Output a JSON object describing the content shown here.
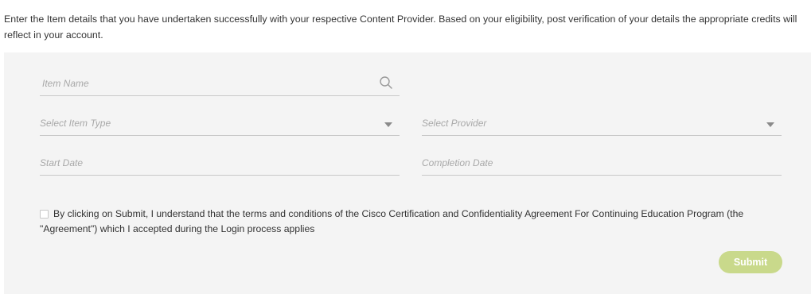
{
  "intro": {
    "text": "Enter the Item details that you have undertaken successfully with your respective Content Provider. Based on your eligibility, post verification of your details the appropriate credits will reflect in your account."
  },
  "form": {
    "item_name": {
      "placeholder": "Item Name",
      "icon": "search-icon"
    },
    "item_type": {
      "placeholder": "Select Item Type",
      "icon": "caret-down-icon"
    },
    "provider": {
      "placeholder": "Select Provider",
      "icon": "caret-down-icon"
    },
    "start_date": {
      "placeholder": "Start Date"
    },
    "completion_date": {
      "placeholder": "Completion Date"
    },
    "agreement": {
      "checked": false,
      "text": "By clicking on Submit, I understand that the terms and conditions of the Cisco Certification and Confidentiality Agreement For Continuing Education Program (the \"Agreement\") which I accepted during the Login process applies"
    },
    "submit_label": "Submit"
  },
  "colors": {
    "panel_background": "#f4f4f4",
    "submit_background": "#c9d98b",
    "placeholder_text": "#a8a8a8",
    "underline": "#c8c8c8"
  }
}
